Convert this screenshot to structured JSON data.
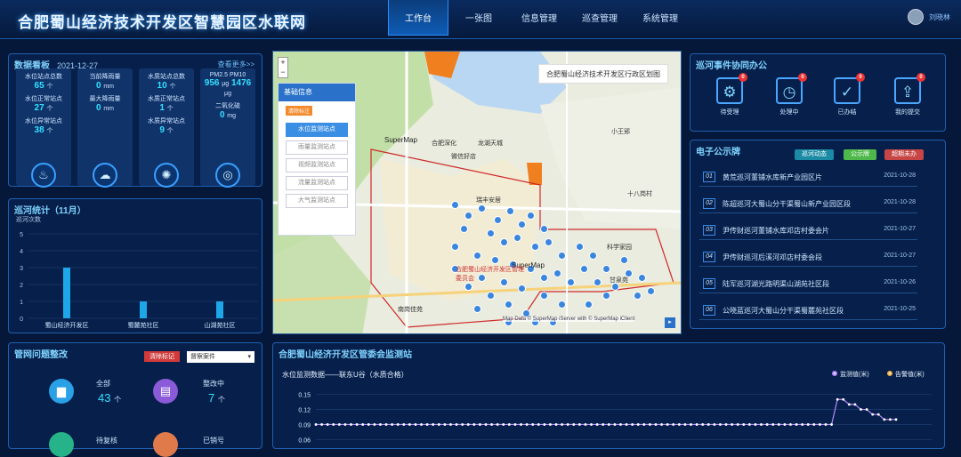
{
  "header": {
    "title": "合肥蜀山经济技术开发区智慧园区水联网",
    "nav": [
      "工作台",
      "一张图",
      "信息管理",
      "巡查管理",
      "系统管理"
    ],
    "user": "刘晓林"
  },
  "stats": {
    "title": "数据看板",
    "date": "2021-12-27",
    "more": "查看更多>>",
    "cards": [
      {
        "rows": [
          {
            "l": "水位站点总数",
            "v": "65",
            "u": "个"
          },
          {
            "l": "水位正常站点",
            "v": "27",
            "u": "个"
          },
          {
            "l": "水位异常站点",
            "v": "38",
            "u": "个"
          }
        ],
        "icon": "water-drop-icon"
      },
      {
        "rows": [
          {
            "l": "当前降雨量",
            "v": "0",
            "u": "mm"
          },
          {
            "l": "最大降雨量",
            "v": "0",
            "u": "mm"
          }
        ],
        "icon": "rain-cloud-icon"
      },
      {
        "rows": [
          {
            "l": "水质站点总数",
            "v": "10",
            "u": "个"
          },
          {
            "l": "水质正常站点",
            "v": "1",
            "u": "个"
          },
          {
            "l": "水质异常站点",
            "v": "9",
            "u": "个"
          }
        ],
        "icon": "water-quality-icon"
      },
      {
        "rows": [
          {
            "l": "PM2.5  PM10",
            "v": "956",
            "u": "μg",
            "v2": "1476",
            "u2": "μg"
          },
          {
            "l": "二氧化硫",
            "v": "0",
            "u": "mg"
          }
        ],
        "icon": "air-icon"
      }
    ]
  },
  "patrol": {
    "title": "巡河统计（11月）",
    "ylabel": "巡河次数"
  },
  "chart_data": [
    {
      "type": "bar",
      "title": "巡河统计（11月）",
      "ylabel": "巡河次数",
      "categories": [
        "蜀山经济开发区",
        "蜀麓苑社区",
        "山湖苑社区"
      ],
      "values": [
        3,
        1,
        1
      ],
      "ylim": [
        0,
        5
      ],
      "yticks": [
        0,
        1,
        2,
        3,
        4,
        5
      ]
    },
    {
      "type": "line",
      "title": "水位监测数据——联东U谷（水质合格）",
      "series": [
        {
          "name": "监测值(米)",
          "values": [
            0.09,
            0.09,
            0.09,
            0.09,
            0.09,
            0.09,
            0.09,
            0.09,
            0.09,
            0.09,
            0.09,
            0.09,
            0.09,
            0.09,
            0.09,
            0.09,
            0.09,
            0.09,
            0.09,
            0.09,
            0.09,
            0.09,
            0.09,
            0.09,
            0.09,
            0.09,
            0.09,
            0.09,
            0.09,
            0.09,
            0.09,
            0.09,
            0.09,
            0.09,
            0.09,
            0.09,
            0.09,
            0.09,
            0.09,
            0.09,
            0.09,
            0.09,
            0.09,
            0.09,
            0.09,
            0.09,
            0.09,
            0.09,
            0.09,
            0.09,
            0.09,
            0.09,
            0.09,
            0.09,
            0.09,
            0.09,
            0.09,
            0.09,
            0.09,
            0.09,
            0.09,
            0.09,
            0.09,
            0.09,
            0.09,
            0.09,
            0.09,
            0.09,
            0.09,
            0.09,
            0.09,
            0.09,
            0.09,
            0.09,
            0.09,
            0.09,
            0.09,
            0.09,
            0.09,
            0.09,
            0.09,
            0.09,
            0.09,
            0.09,
            0.09,
            0.09,
            0.09,
            0.09,
            0.09,
            0.14,
            0.14,
            0.13,
            0.13,
            0.12,
            0.12,
            0.11,
            0.11,
            0.1,
            0.1,
            0.1
          ]
        },
        {
          "name": "告警值(米)",
          "values": []
        }
      ],
      "yticks": [
        0.15,
        0.12,
        0.09,
        0.06
      ],
      "ylim": [
        0.05,
        0.16
      ]
    }
  ],
  "events": {
    "title": "巡河事件协同办公",
    "items": [
      {
        "l": "待受理",
        "b": "0",
        "i": "gear-icon"
      },
      {
        "l": "处理中",
        "b": "0",
        "i": "clock-icon"
      },
      {
        "l": "已办结",
        "b": "0",
        "i": "check-icon"
      },
      {
        "l": "我的提交",
        "b": "0",
        "i": "upload-icon"
      }
    ]
  },
  "notice": {
    "title": "电子公示牌",
    "tags": [
      "巡河动态",
      "公示牌",
      "超期未办"
    ],
    "rows": [
      {
        "n": "01",
        "t": "黄荒巡河董铺水库新产业园区片",
        "d": "2021-10-28"
      },
      {
        "n": "02",
        "t": "陈超巡河大蜀山分干渠蜀山新产业园区段",
        "d": "2021-10-28"
      },
      {
        "n": "03",
        "t": "尹传财巡河董铺水库邓店村委会片",
        "d": "2021-10-27"
      },
      {
        "n": "04",
        "t": "尹传财巡河后溪河邓店村委会段",
        "d": "2021-10-27"
      },
      {
        "n": "05",
        "t": "陆军巡河湖光路明渠山湖苑社区段",
        "d": "2021-10-26"
      },
      {
        "n": "06",
        "t": "公晓蓝巡河大蜀山分干渠蜀麓苑社区段",
        "d": "2021-10-25"
      }
    ]
  },
  "map": {
    "title": "合肥蜀山经济技术开发区行政区划图",
    "base": "基础信息",
    "tag": "清除标注",
    "btns": [
      "水位监测站点",
      "雨量监测站点",
      "视频监测站点",
      "流量监测站点",
      "大气监测站点"
    ],
    "credit": "Map Data © SuperMap iServer with © SuperMap iClient",
    "labels": [
      "SuperMap",
      "SuperMap",
      "合肥蜀山经济开发区管理委员会",
      "科学家园",
      "小王郢",
      "十八岗村",
      "南岗佳苑",
      "甘泉苑",
      "合肥深化",
      "龙湖天城",
      "瑞丰安居",
      "微信好店"
    ]
  },
  "issues": {
    "title": "管网问题整改",
    "btn": "清除标记",
    "select": "督察案件",
    "items": [
      {
        "l": "全部",
        "v": "43",
        "u": "个"
      },
      {
        "l": "整改中",
        "v": "7",
        "u": "个"
      },
      {
        "l": "待复核",
        "v": "",
        "u": ""
      },
      {
        "l": "已销号",
        "v": "",
        "u": ""
      }
    ]
  },
  "station": {
    "title": "合肥蜀山经济开发区管委会监测站",
    "sub": "水位监测数据——联东U谷（水质合格）",
    "legend": [
      "监测值(米)",
      "告警值(米)"
    ]
  }
}
